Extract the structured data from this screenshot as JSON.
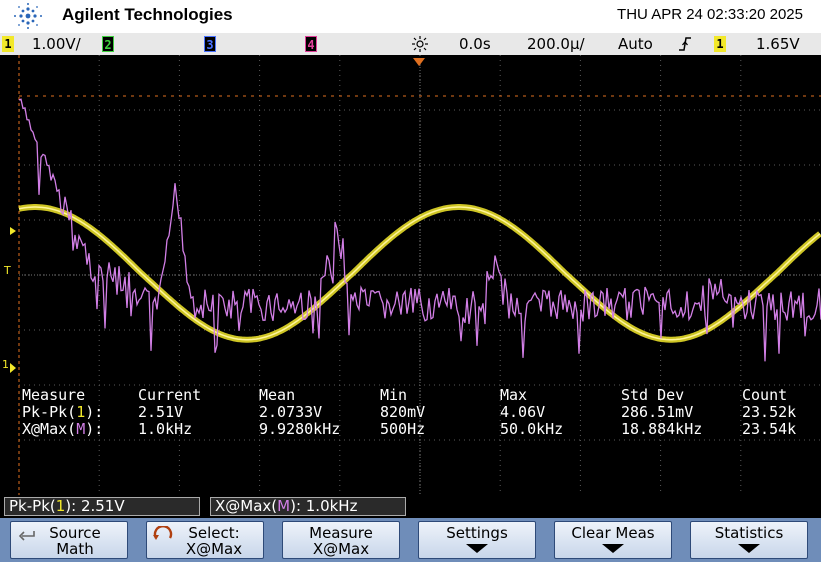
{
  "header": {
    "brand": "Agilent Technologies",
    "datetime": "THU APR 24 02:33:20 2025"
  },
  "status": {
    "ch1_num": "1",
    "ch1_scale": "1.00V/",
    "ch2_num": "2",
    "ch3_num": "3",
    "ch4_num": "4",
    "delay": "0.0s",
    "timebase": "200.0µ/",
    "trigger_mode": "Auto",
    "trigger_source": "1",
    "trigger_level": "1.65V"
  },
  "screen_markers": {
    "trigger_marker": "T",
    "ground_marker": "1"
  },
  "measurements": {
    "headers": [
      "Measure",
      "Current",
      "Mean",
      "Min",
      "Max",
      "Std Dev",
      "Count"
    ],
    "row1": {
      "label_a": "Pk-Pk(",
      "ch": "1",
      "label_b": "):",
      "values": [
        "2.51V",
        "2.0733V",
        "820mV",
        "4.06V",
        "286.51mV",
        "23.52k"
      ]
    },
    "row2": {
      "label_a": "X@Max(",
      "ch": "M",
      "label_b": "):",
      "values": [
        "1.0kHz",
        "9.9280kHz",
        "500Hz",
        "50.0kHz",
        "18.884kHz",
        "23.54k"
      ]
    }
  },
  "quick_readouts": [
    {
      "label_a": "Pk-Pk(",
      "ch": "1",
      "label_b": "): 2.51V"
    },
    {
      "label_a": "X@Max(",
      "ch": "M",
      "label_b": "): 1.0kHz"
    }
  ],
  "softkeys": [
    {
      "line1": "Source",
      "line2": "Math",
      "icon": "return-arrow-icon"
    },
    {
      "line1": "Select:",
      "line2": "X@Max",
      "icon": "rotary-knob-icon"
    },
    {
      "line1": "Measure",
      "line2": "X@Max",
      "icon": ""
    },
    {
      "line1": "Settings",
      "line2": "",
      "icon": "down-arrow-icon"
    },
    {
      "line1": "Clear Meas",
      "line2": "",
      "icon": "down-arrow-icon"
    },
    {
      "line1": "Statistics",
      "line2": "",
      "icon": "down-arrow-icon"
    }
  ],
  "colors": {
    "ch1": "#f2e82a",
    "ch2": "#3fd13f",
    "ch3": "#4a72ff",
    "ch4": "#e0409a",
    "math": "#d27fe6",
    "trigger_line": "#e07020"
  },
  "waveforms": {
    "channel1": "yellow sine-like wave ~1.0kHz",
    "math": "FFT spectrum (magenta)"
  }
}
